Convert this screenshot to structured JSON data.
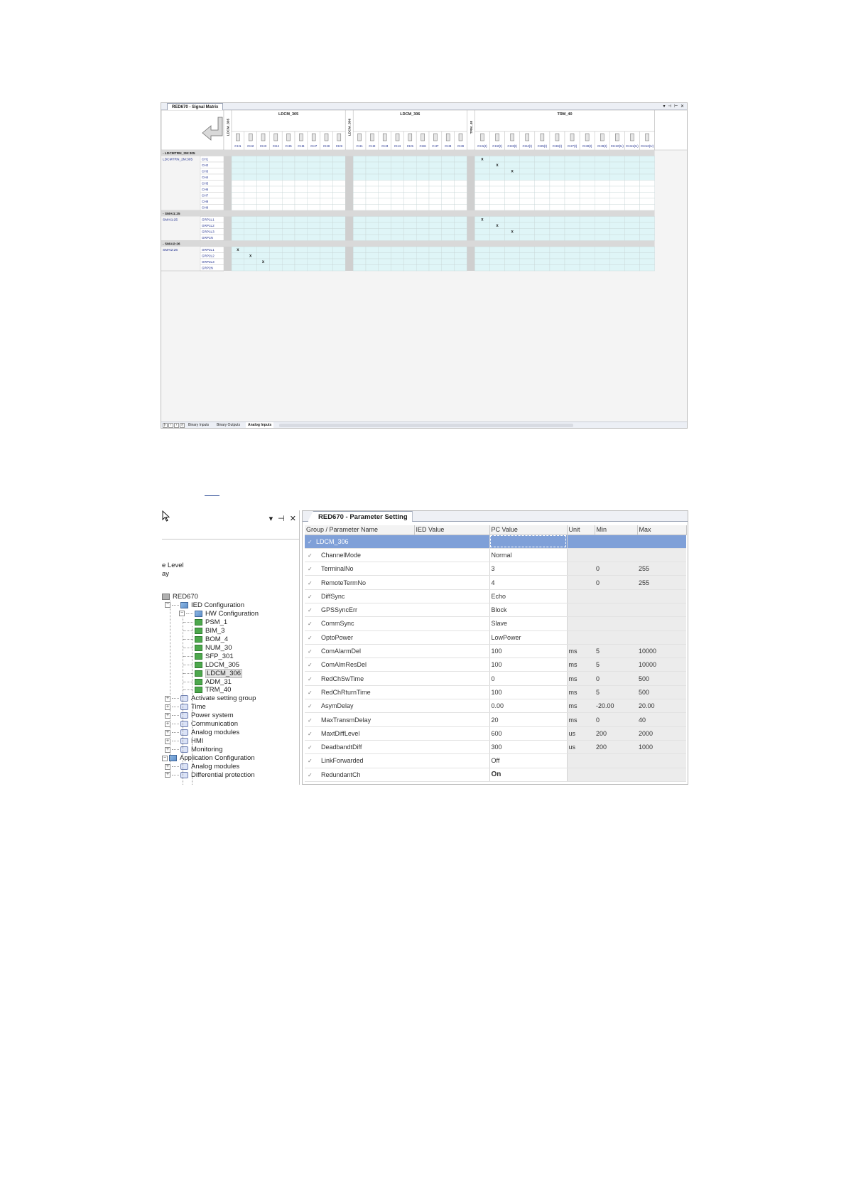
{
  "signal_matrix": {
    "window_title": "RED670 - Signal Matrix",
    "window_controls": "▾ ⊣ ⊢ ✕",
    "group_headers": [
      "LDCM_305",
      "LDCM_306",
      "TRM_40"
    ],
    "vertical_labels": [
      "LDCM_305",
      "LDCM_306",
      "TRM_40"
    ],
    "ldcm_columns": [
      "CH1",
      "CH2",
      "CH3",
      "CH4",
      "CH5",
      "CH6",
      "CH7",
      "CH8",
      "CH9"
    ],
    "trm_columns": [
      "CH1(I)",
      "CH2(I)",
      "CH3(I)",
      "CH4(I)",
      "CH5(I)",
      "CH6(I)",
      "CH7(I)",
      "CH8(I)",
      "CH9(I)",
      "CH10(U)",
      "CH11(U)",
      "CH12(U)"
    ],
    "sections": [
      {
        "title": "- LDCMTRN_2M:305",
        "source": "LDCMTRN_2M:305",
        "rows": [
          "CH1",
          "CH2",
          "CH3",
          "CH4",
          "CH5",
          "CH6",
          "CH7",
          "CH8",
          "CH9"
        ]
      },
      {
        "title": "- SMAI1:25",
        "source": "SMAI1:25",
        "rows": [
          "GRP1L1",
          "GRP1L2",
          "GRP1L3",
          "GRP1N"
        ]
      },
      {
        "title": "- SMAI2:26",
        "source": "SMAI2:26",
        "rows": [
          "GRP2L1",
          "GRP2L2",
          "GRP2L3",
          "GRP2N"
        ]
      }
    ],
    "marks": [
      {
        "section": 0,
        "row": 0,
        "group": 2,
        "col": 0
      },
      {
        "section": 0,
        "row": 1,
        "group": 2,
        "col": 1
      },
      {
        "section": 0,
        "row": 2,
        "group": 2,
        "col": 2
      },
      {
        "section": 1,
        "row": 0,
        "group": 2,
        "col": 0
      },
      {
        "section": 1,
        "row": 1,
        "group": 2,
        "col": 1
      },
      {
        "section": 1,
        "row": 2,
        "group": 2,
        "col": 2
      },
      {
        "section": 2,
        "row": 0,
        "group": 0,
        "col": 0
      },
      {
        "section": 2,
        "row": 1,
        "group": 0,
        "col": 1
      },
      {
        "section": 2,
        "row": 2,
        "group": 0,
        "col": 2
      }
    ],
    "mark_symbol": "x",
    "sheet_tabs": [
      "Binary Inputs",
      "Binary Outputs",
      "Analog Inputs"
    ],
    "active_sheet": "Analog Inputs",
    "colors": {
      "row_fill": "#dff5f7",
      "section_fill": "#d9d9d9",
      "header_text": "#1f2f8f"
    }
  },
  "tree": {
    "panel_controls": "▾ ⊣ ✕",
    "partial_labels": [
      "e Level",
      "ay"
    ],
    "nodes": [
      {
        "label": "RED670",
        "icon": "ied-icon",
        "expander": ""
      },
      {
        "label": "IED Configuration",
        "icon": "config-icon",
        "expander": "−"
      },
      {
        "label": "HW Configuration",
        "icon": "hw-config-icon",
        "expander": "−"
      },
      {
        "label": "PSM_1",
        "icon": "module-icon",
        "expander": ""
      },
      {
        "label": "BIM_3",
        "icon": "module-icon",
        "expander": ""
      },
      {
        "label": "BOM_4",
        "icon": "module-icon",
        "expander": ""
      },
      {
        "label": "NUM_30",
        "icon": "module-icon",
        "expander": ""
      },
      {
        "label": "SFP_301",
        "icon": "module-icon",
        "expander": ""
      },
      {
        "label": "LDCM_305",
        "icon": "module-icon",
        "expander": ""
      },
      {
        "label": "LDCM_306",
        "icon": "module-icon",
        "expander": "",
        "selected": true
      },
      {
        "label": "ADM_31",
        "icon": "module-icon",
        "expander": ""
      },
      {
        "label": "TRM_40",
        "icon": "module-icon",
        "expander": ""
      },
      {
        "label": "Activate setting group",
        "icon": "group-icon",
        "expander": "+"
      },
      {
        "label": "Time",
        "icon": "group-icon",
        "expander": "+"
      },
      {
        "label": "Power system",
        "icon": "group-icon",
        "expander": "+"
      },
      {
        "label": "Communication",
        "icon": "group-icon",
        "expander": "+"
      },
      {
        "label": "Analog modules",
        "icon": "group-icon",
        "expander": "+"
      },
      {
        "label": "HMI",
        "icon": "group-icon",
        "expander": "+"
      },
      {
        "label": "Monitoring",
        "icon": "group-icon",
        "expander": "+"
      },
      {
        "label": "Application Configuration",
        "icon": "config-icon",
        "expander": "−"
      },
      {
        "label": "Analog modules",
        "icon": "group-icon",
        "expander": "+"
      },
      {
        "label": "Differential protection",
        "icon": "group-icon",
        "expander": "+"
      }
    ]
  },
  "parameter_setting": {
    "window_title": "RED670 - Parameter Setting",
    "columns": [
      "Group / Parameter Name",
      "IED Value",
      "PC Value",
      "Unit",
      "Min",
      "Max"
    ],
    "group_row": "LDCM_306",
    "rows": [
      {
        "name": "ChannelMode",
        "ied": "",
        "pc": "Normal",
        "unit": "",
        "min": "",
        "max": ""
      },
      {
        "name": "TerminalNo",
        "ied": "",
        "pc": "3",
        "unit": "",
        "min": "0",
        "max": "255"
      },
      {
        "name": "RemoteTermNo",
        "ied": "",
        "pc": "4",
        "unit": "",
        "min": "0",
        "max": "255"
      },
      {
        "name": "DiffSync",
        "ied": "",
        "pc": "Echo",
        "unit": "",
        "min": "",
        "max": ""
      },
      {
        "name": "GPSSyncErr",
        "ied": "",
        "pc": "Block",
        "unit": "",
        "min": "",
        "max": ""
      },
      {
        "name": "CommSync",
        "ied": "",
        "pc": "Slave",
        "unit": "",
        "min": "",
        "max": ""
      },
      {
        "name": "OptoPower",
        "ied": "",
        "pc": "LowPower",
        "unit": "",
        "min": "",
        "max": ""
      },
      {
        "name": "ComAlarmDel",
        "ied": "",
        "pc": "100",
        "unit": "ms",
        "min": "5",
        "max": "10000"
      },
      {
        "name": "ComAlmResDel",
        "ied": "",
        "pc": "100",
        "unit": "ms",
        "min": "5",
        "max": "10000"
      },
      {
        "name": "RedChSwTime",
        "ied": "",
        "pc": "0",
        "unit": "ms",
        "min": "0",
        "max": "500"
      },
      {
        "name": "RedChRturnTime",
        "ied": "",
        "pc": "100",
        "unit": "ms",
        "min": "5",
        "max": "500"
      },
      {
        "name": "AsymDelay",
        "ied": "",
        "pc": "0.00",
        "unit": "ms",
        "min": "-20.00",
        "max": "20.00"
      },
      {
        "name": "MaxTransmDelay",
        "ied": "",
        "pc": "20",
        "unit": "ms",
        "min": "0",
        "max": "40"
      },
      {
        "name": "MaxtDiffLevel",
        "ied": "",
        "pc": "600",
        "unit": "us",
        "min": "200",
        "max": "2000"
      },
      {
        "name": "DeadbandtDiff",
        "ied": "",
        "pc": "300",
        "unit": "us",
        "min": "200",
        "max": "1000"
      },
      {
        "name": "LinkForwarded",
        "ied": "",
        "pc": "Off",
        "unit": "",
        "min": "",
        "max": ""
      },
      {
        "name": "RedundantCh",
        "ied": "",
        "pc": "On",
        "unit": "",
        "min": "",
        "max": "",
        "bold": true
      }
    ]
  }
}
